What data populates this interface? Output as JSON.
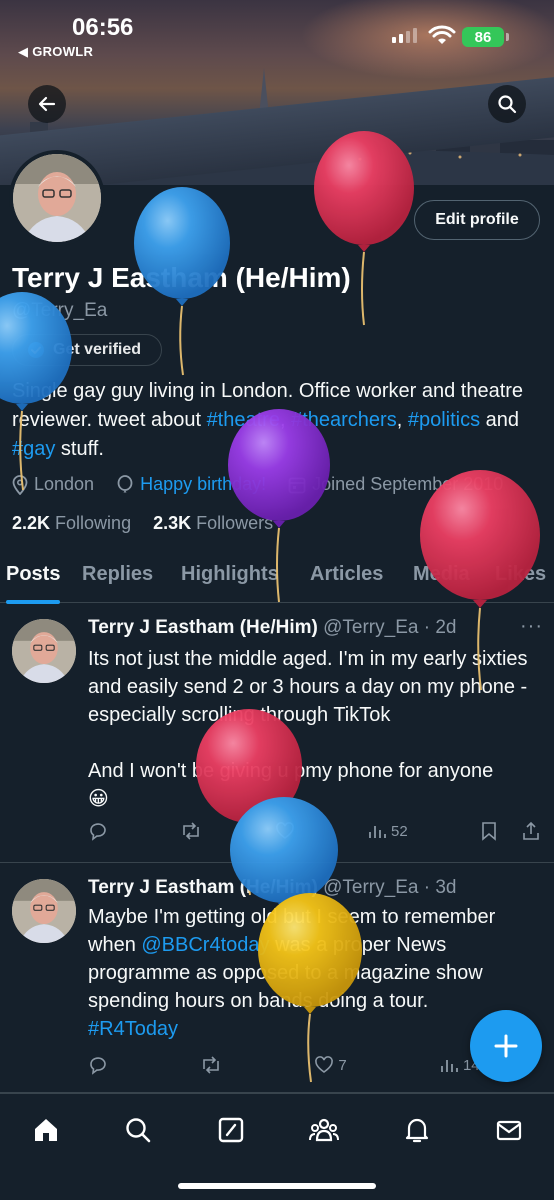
{
  "status_bar": {
    "time": "06:56",
    "back_app": "◀ GROWLR",
    "battery": "86"
  },
  "profile": {
    "name": "Terry J Eastham (He/Him)",
    "handle": "@Terry_Ea",
    "edit_label": "Edit profile",
    "verify_label": "Get verified",
    "bio_parts": {
      "p1": "Single gay guy living in London. Office worker and theatre reviewer. tweet about ",
      "t1": "#theatre",
      "p2": ", ",
      "t2": "#thearchers",
      "p3": ", ",
      "t3": "#politics",
      "p4": " and ",
      "t4": "#gay",
      "p5": " stuff."
    },
    "location": "London",
    "birthday": "Happy birthday!",
    "joined": "Joined September 2010",
    "following_count": "2.2K",
    "following_label": "Following",
    "followers_count": "2.3K",
    "followers_label": "Followers"
  },
  "tabs": [
    "Posts",
    "Replies",
    "Highlights",
    "Articles",
    "Media",
    "Likes"
  ],
  "posts": [
    {
      "name": "Terry J Eastham (He/Him)",
      "handle_time": "@Terry_Ea · 2d",
      "text1": "Its not just the middle aged. I'm in my early sixties and easily send 2 or 3 hours a day on my phone - especially scrolling through TikTok",
      "text2": "And I won't be giving u pmy phone for anyone",
      "emoji": "😀",
      "views": "52"
    },
    {
      "name": "Terry J Eastham (He/Him)",
      "handle_time": "@Terry_Ea · 3d",
      "text_a": "Maybe I'm getting old but I seem to remember when ",
      "mention": "@BBCr4today",
      "text_b": " was a proper News programme as opposed to a magazine show spending hours on bands doing a tour.",
      "hashtag": "#R4Today",
      "likes": "7",
      "views": "143"
    }
  ],
  "colors": {
    "background": "#15202b",
    "accent": "#1d9bf0",
    "muted": "#8b98a5",
    "border": "#38444d"
  }
}
